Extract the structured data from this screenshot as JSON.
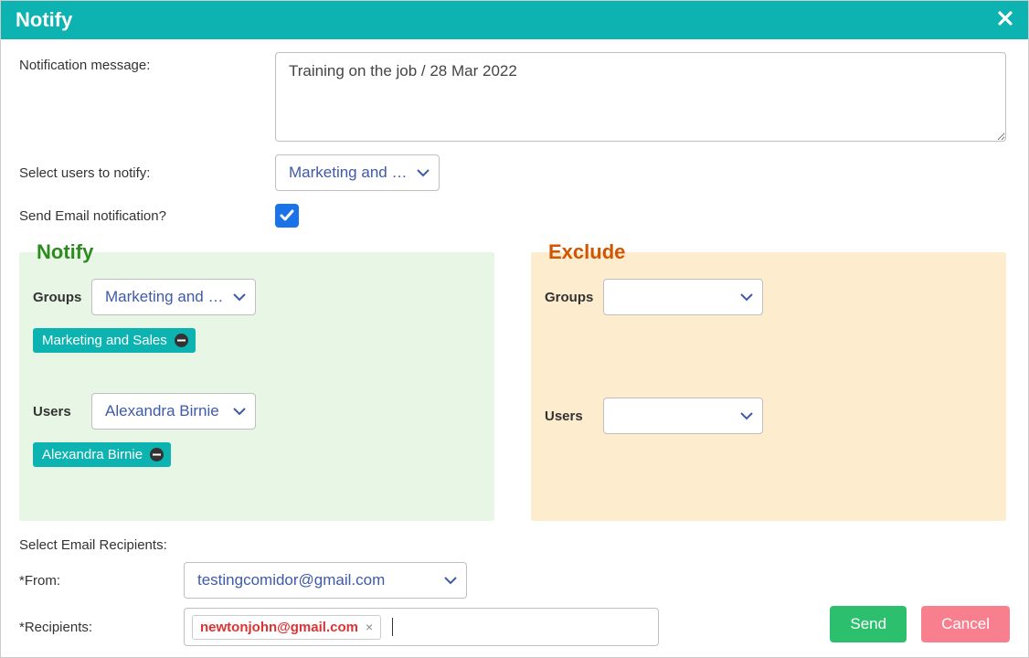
{
  "header": {
    "title": "Notify"
  },
  "form": {
    "notification_label": "Notification message:",
    "notification_value": "Training on the job / 28 Mar 2022",
    "select_users_label": "Select users to notify:",
    "select_users_value": "Marketing and …",
    "send_email_label": "Send Email notification?",
    "send_email_checked": true
  },
  "notify_box": {
    "legend": "Notify",
    "groups_label": "Groups",
    "groups_value": "Marketing and …",
    "groups_tag": "Marketing and Sales",
    "users_label": "Users",
    "users_value": "Alexandra Birnie",
    "users_tag": "Alexandra Birnie"
  },
  "exclude_box": {
    "legend": "Exclude",
    "groups_label": "Groups",
    "groups_value": "",
    "users_label": "Users",
    "users_value": ""
  },
  "email": {
    "section_label": "Select Email Recipients:",
    "from_label": "*From:",
    "from_value": "testingcomidor@gmail.com",
    "recipients_label": "*Recipients:",
    "recipient_tag": "newtonjohn@gmail.com"
  },
  "footer": {
    "send": "Send",
    "cancel": "Cancel"
  }
}
